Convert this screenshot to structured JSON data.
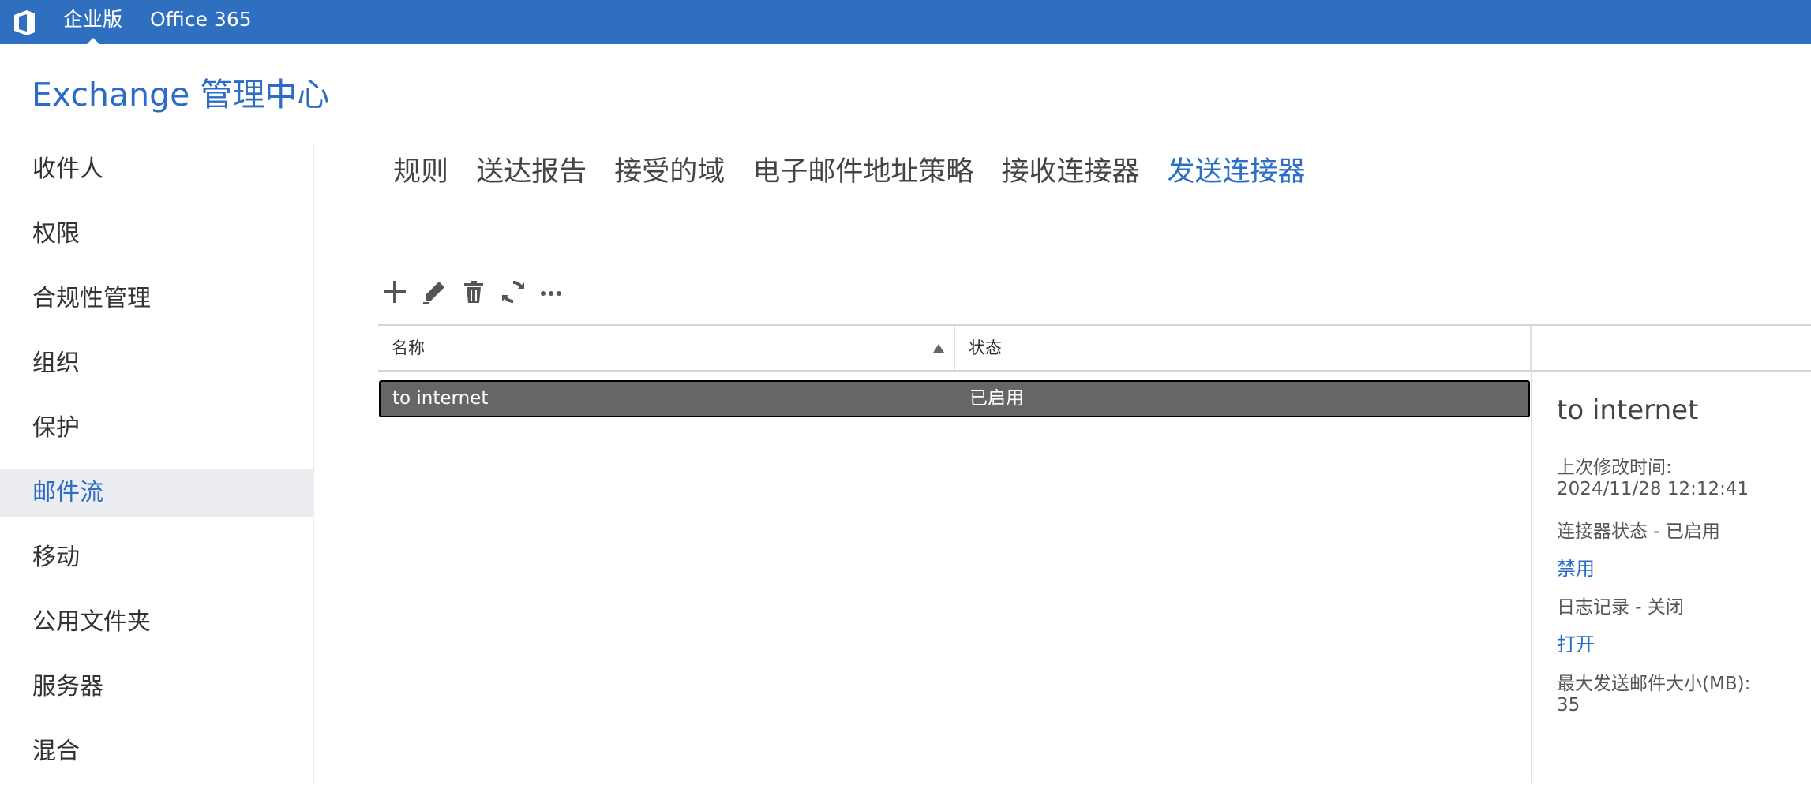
{
  "topbar": {
    "logo_icon": "office-logo-icon",
    "edition_label": "企业版",
    "product_label": "Office 365",
    "background": "#2f6fbf"
  },
  "header": {
    "title": "Exchange 管理中心"
  },
  "sidebar": {
    "items": [
      {
        "label": "收件人"
      },
      {
        "label": "权限"
      },
      {
        "label": "合规性管理"
      },
      {
        "label": "组织"
      },
      {
        "label": "保护"
      },
      {
        "label": "邮件流",
        "active": true
      },
      {
        "label": "移动"
      },
      {
        "label": "公用文件夹"
      },
      {
        "label": "服务器"
      },
      {
        "label": "混合"
      }
    ]
  },
  "tabs": [
    {
      "label": "规则"
    },
    {
      "label": "送达报告"
    },
    {
      "label": "接受的域"
    },
    {
      "label": "电子邮件地址策略"
    },
    {
      "label": "接收连接器"
    },
    {
      "label": "发送连接器",
      "active": true
    }
  ],
  "toolbar": {
    "buttons": [
      "add-icon",
      "edit-icon",
      "delete-icon",
      "refresh-icon",
      "more-icon"
    ]
  },
  "table": {
    "columns": [
      "名称",
      "状态"
    ],
    "sort": {
      "column": "名称",
      "direction": "ascending"
    },
    "rows": [
      {
        "name": "to internet",
        "status": "已启用",
        "selected": true
      }
    ]
  },
  "details": {
    "title": "to internet",
    "last_modified_label": "上次修改时间:",
    "last_modified_value": "2024/11/28 12:12:41",
    "connector_status": "连接器状态 - 已启用",
    "disable_link": "禁用",
    "logging_status": "日志记录 - 关闭",
    "enable_link": "打开",
    "max_size_label": "最大发送邮件大小(MB):",
    "max_size_value": "35"
  },
  "colors": {
    "accent": "#2b6cc4",
    "selected_row": "#666666"
  }
}
